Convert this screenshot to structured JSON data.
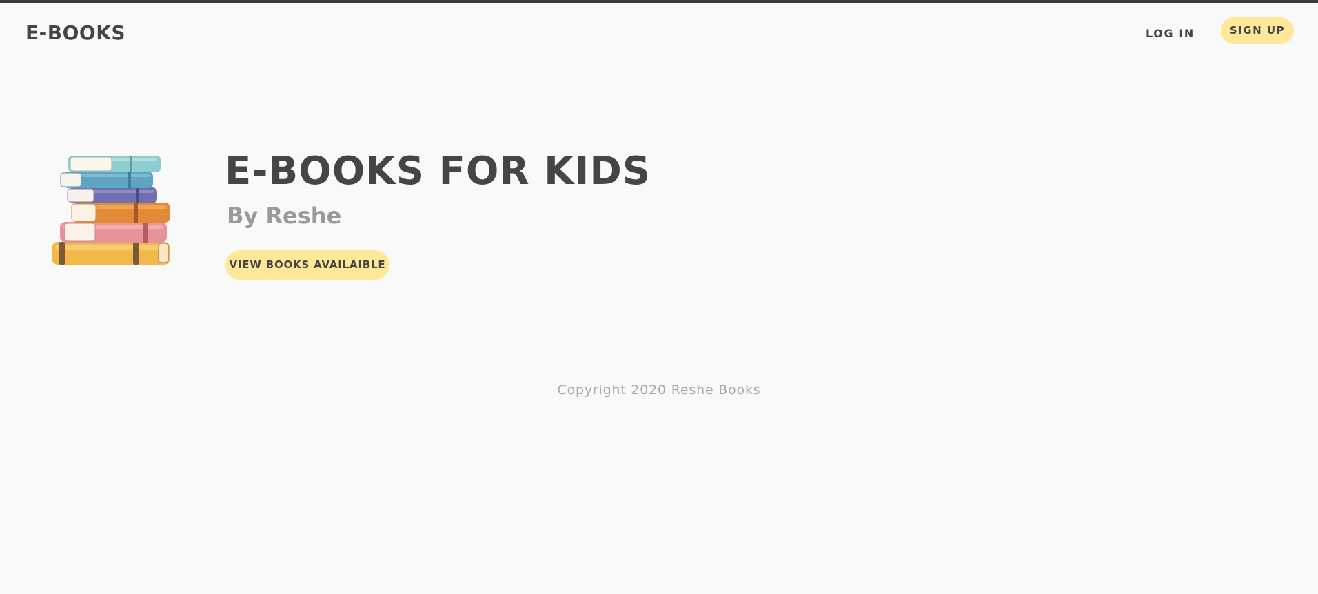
{
  "header": {
    "brand": "E-BOOKS",
    "login_label": "LOG IN",
    "signup_label": "SIGN UP"
  },
  "hero": {
    "image_icon": "stack-of-books-illustration",
    "title": "E-BOOKS FOR KIDS",
    "subtitle": "By Reshe",
    "cta_label": "VIEW BOOKS AVAILAIBLE"
  },
  "footer": {
    "copyright": "Copyright 2020 Reshe Books"
  },
  "colors": {
    "background": "#f9f9f9",
    "top_strip": "#3a3a3a",
    "text_dark": "#454545",
    "text_muted": "#9a9a9a",
    "button_yellow": "#ffe898"
  }
}
